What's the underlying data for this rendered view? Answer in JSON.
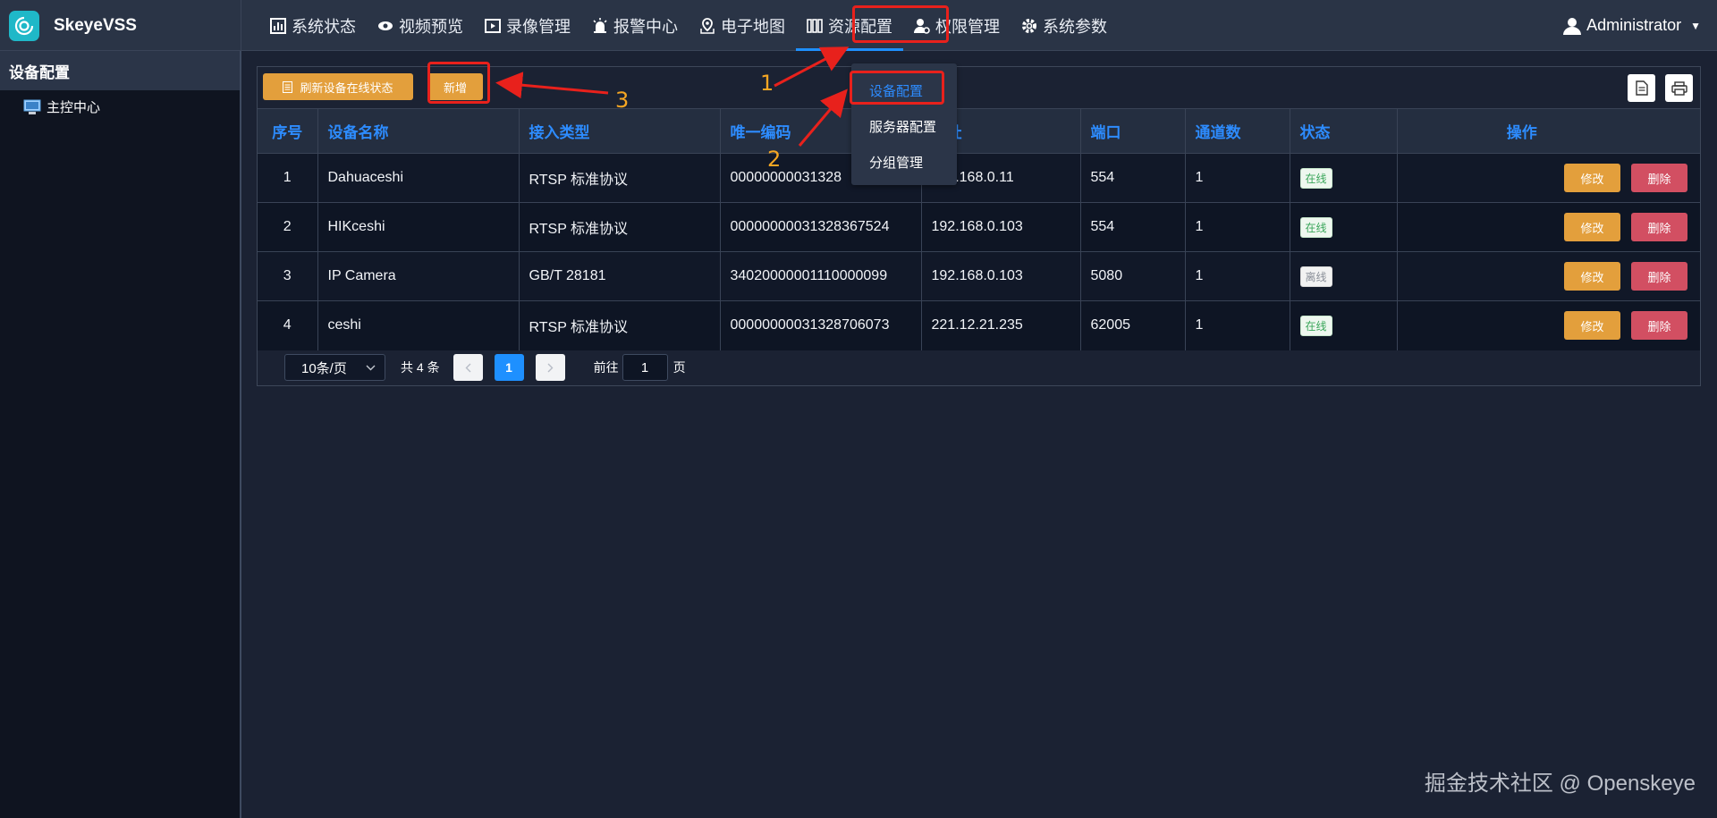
{
  "app": {
    "name": "SkeyeVSS",
    "user": "Administrator"
  },
  "nav": {
    "items": [
      {
        "label": "系统状态",
        "icon": "bar-chart-icon"
      },
      {
        "label": "视频预览",
        "icon": "camera-icon"
      },
      {
        "label": "录像管理",
        "icon": "film-icon"
      },
      {
        "label": "报警中心",
        "icon": "alarm-icon"
      },
      {
        "label": "电子地图",
        "icon": "map-icon"
      },
      {
        "label": "资源配置",
        "icon": "books-icon"
      },
      {
        "label": "权限管理",
        "icon": "user-gear-icon"
      },
      {
        "label": "系统参数",
        "icon": "gear-icon"
      }
    ],
    "active": "资源配置"
  },
  "sidebar": {
    "title": "设备配置",
    "tree_item": "主控中心"
  },
  "toolbar": {
    "refresh_label": "刷新设备在线状态",
    "add_label": "新增"
  },
  "table": {
    "columns": [
      "序号",
      "设备名称",
      "接入类型",
      "唯一编码",
      "地址",
      "端口",
      "通道数",
      "状态",
      "操作"
    ],
    "rows": [
      {
        "index": "1",
        "name": "Dahuaceshi",
        "type": "RTSP 标准协议",
        "code": "00000000031328",
        "address": "192.168.0.11",
        "port": "554",
        "channels": "1",
        "status": "在线",
        "online": true
      },
      {
        "index": "2",
        "name": "HIKceshi",
        "type": "RTSP 标准协议",
        "code": "00000000031328367524",
        "address": "192.168.0.103",
        "port": "554",
        "channels": "1",
        "status": "在线",
        "online": true
      },
      {
        "index": "3",
        "name": "IP Camera",
        "type": "GB/T 28181",
        "code": "34020000001110000099",
        "address": "192.168.0.103",
        "port": "5080",
        "channels": "1",
        "status": "离线",
        "online": false
      },
      {
        "index": "4",
        "name": "ceshi",
        "type": "RTSP 标准协议",
        "code": "00000000031328706073",
        "address": "221.12.21.235",
        "port": "62005",
        "channels": "1",
        "status": "在线",
        "online": true
      }
    ],
    "edit_label": "修改",
    "delete_label": "删除"
  },
  "pager": {
    "page_size": "10条/页",
    "total": "共 4 条",
    "current_page": "1",
    "goto_prefix": "前往",
    "goto_value": "1",
    "goto_suffix": "页"
  },
  "dropdown": {
    "items": [
      "设备配置",
      "服务器配置",
      "分组管理"
    ],
    "active": "设备配置"
  },
  "annotations": {
    "step1": "1",
    "step2": "2",
    "step3": "3"
  },
  "watermark": "掘金技术社区 @ Openskeye",
  "colors": {
    "accent": "#1e90ff",
    "warning": "#e39f3c",
    "danger": "#d24f62",
    "annotation_red": "#e8211c",
    "annotation_number": "#f5a623"
  }
}
